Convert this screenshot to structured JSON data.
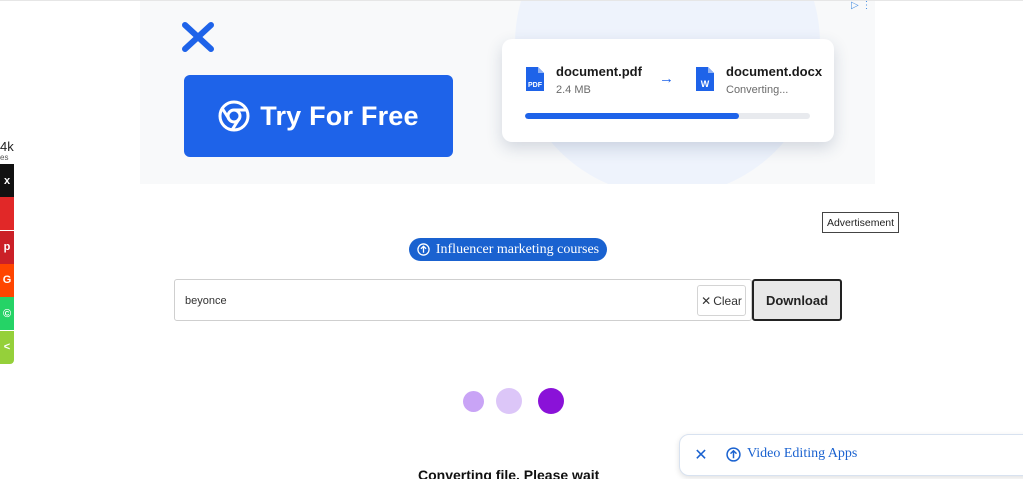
{
  "ad": {
    "cta_label": "Try For Free",
    "file_from": {
      "name": "document.pdf",
      "meta": "2.4 MB",
      "icon": "pdf-file-icon",
      "badge": "PDF"
    },
    "file_to": {
      "name": "document.docx",
      "meta": "Converting...",
      "icon": "word-file-icon",
      "badge": "W"
    },
    "progress": 0.75,
    "label": "Advertisement",
    "colors": {
      "brand": "#1e63e9"
    }
  },
  "share": {
    "count": "4k",
    "sub": "es",
    "buttons": [
      {
        "icon": "x-share-icon",
        "glyph": "x",
        "color": "#111111"
      },
      {
        "icon": "flipboard-share-icon",
        "glyph": "",
        "color": "#e12828"
      },
      {
        "icon": "pinterest-share-icon",
        "glyph": "p",
        "color": "#cb2027"
      },
      {
        "icon": "reddit-share-icon",
        "glyph": "G",
        "color": "#ff4500"
      },
      {
        "icon": "whatsapp-share-icon",
        "glyph": "©",
        "color": "#25d366"
      },
      {
        "icon": "sharethis-icon",
        "glyph": "<",
        "color": "#95d03a"
      }
    ]
  },
  "pill": {
    "label": "Influencer marketing courses",
    "icon": "circle-arrow-icon"
  },
  "search": {
    "value": "beyonce",
    "clear_label": "Clear",
    "download_label": "Download"
  },
  "loader": {
    "colors": [
      "#c9a4f6",
      "#dcc6f8",
      "#8a12d8"
    ]
  },
  "status": "Converting file. Please wait",
  "floating": {
    "label": "Video Editing Apps",
    "close_icon": "close-icon",
    "icon": "circle-arrow-icon"
  }
}
